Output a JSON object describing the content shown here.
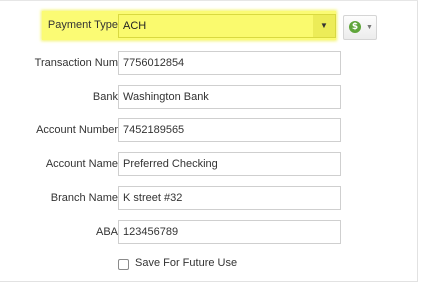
{
  "payment_form": {
    "payment_type": {
      "label": "Payment Type",
      "selected": "ACH",
      "arrow": "▼"
    },
    "action_button": {
      "icon": "dollar-circle-icon",
      "icon_glyph": "$",
      "caret": "▼",
      "accent_color": "#5fa53a"
    },
    "fields": [
      {
        "label": "Transaction Num",
        "value": "7756012854"
      },
      {
        "label": "Bank",
        "value": "Washington Bank"
      },
      {
        "label": "Account Number",
        "value": "7452189565"
      },
      {
        "label": "Account Name",
        "value": "Preferred Checking"
      },
      {
        "label": "Branch Name",
        "value": "K street #32"
      },
      {
        "label": "ABA",
        "value": "123456789"
      }
    ],
    "save_checkbox": {
      "label": "Save For Future Use",
      "checked": false
    },
    "highlight_color": "#fbfb74"
  }
}
